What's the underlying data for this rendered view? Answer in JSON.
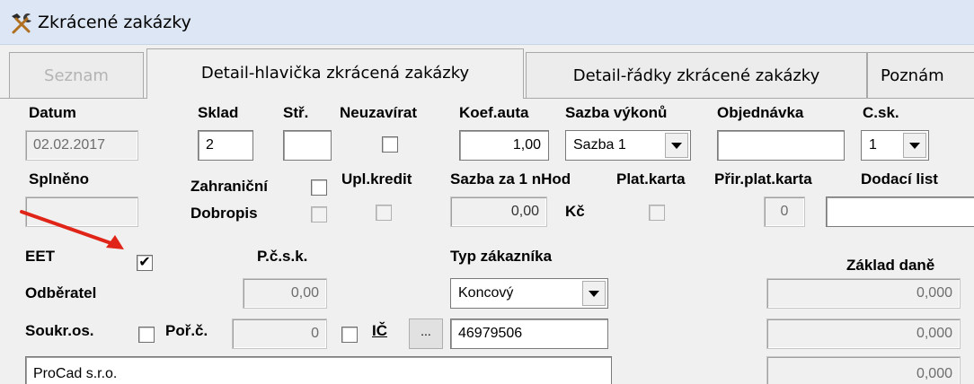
{
  "window": {
    "title": "Zkrácené zakázky"
  },
  "tabs": [
    {
      "label": "Seznam"
    },
    {
      "label": "Detail-hlavička zkrácená zakázky"
    },
    {
      "label": "Detail-řádky zkrácené zakázky"
    },
    {
      "label": "Poznám"
    }
  ],
  "labels": {
    "datum": "Datum",
    "sklad": "Sklad",
    "str": "Stř.",
    "neuzavirat": "Neuzavírat",
    "koef_auta": "Koef.auta",
    "sazba_vykonu": "Sazba výkonů",
    "objednavka": "Objednávka",
    "csk": "C.sk.",
    "splneno": "Splněno",
    "zahranicni": "Zahraniční",
    "upl_kredit": "Upl.kredit",
    "sazba_za_1_nhod": "Sazba za 1 nHod",
    "plat_karta": "Plat.karta",
    "prir_plat_karta": "Přir.plat.karta",
    "dodaci_list": "Dodací list",
    "dobropis": "Dobropis",
    "kc": "Kč",
    "eet": "EET",
    "pcsk": "P.č.s.k.",
    "typ_zakaznika": "Typ zákazníka",
    "zaklad_dane": "Základ daně",
    "odberatel": "Odběratel",
    "soukr_os": "Soukr.os.",
    "por_c": "Poř.č.",
    "ic": "IČ"
  },
  "fields": {
    "datum": "02.02.2017",
    "sklad": "2",
    "str": "",
    "koef_auta": "1,00",
    "sazba_vykonu": "Sazba 1",
    "objednavka": "",
    "csk": "1",
    "splneno": "",
    "sazba_za_1_nhod": "0,00",
    "prir_plat_karta": "0",
    "dodaci_list": "",
    "pcsk": "0,00",
    "typ_zakaznika": "Koncový",
    "por_c": "0",
    "ic": "46979506",
    "ic_button": "...",
    "odberatel_name": "ProCad s.r.o.",
    "zaklad_dane": [
      "0,000",
      "0,000",
      "0,000"
    ]
  },
  "checkboxes": {
    "neuzavirat": false,
    "zahranicni": false,
    "upl_kredit": false,
    "plat_karta": false,
    "dobropis": false,
    "eet": true,
    "soukr_os": false,
    "ic_check": false
  },
  "glyphs": {
    "check": "✔"
  },
  "colors": {
    "annotation_arrow": "#e02418",
    "titlebar": "#dce6f4"
  }
}
